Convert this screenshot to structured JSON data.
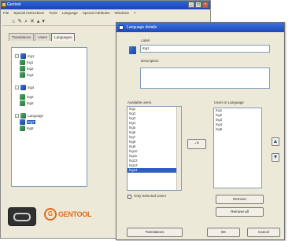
{
  "main_window": {
    "title": "Gentool",
    "menu": [
      "File",
      "Special Instructions",
      "Tools",
      "Language",
      "Special Attributes",
      "Windows",
      "?"
    ],
    "toolbar_icons": [
      "home-icon",
      "pencil-icon",
      "search-icon",
      "delete-icon",
      "up-icon",
      "down-icon"
    ],
    "tabs": [
      "Translations",
      "Users",
      "Languages"
    ],
    "active_tab": 2,
    "tree": [
      {
        "label": "lng1",
        "icon": "blue",
        "expander": "-",
        "selected": false
      },
      {
        "label": "lng1",
        "icon": "green",
        "expander": "",
        "selected": false
      },
      {
        "label": "lng2",
        "icon": "green",
        "expander": "",
        "selected": false
      },
      {
        "label": "lng3",
        "icon": "green",
        "expander": "",
        "selected": false
      },
      {
        "label": "lng4",
        "icon": "blue",
        "expander": "-",
        "selected": false
      },
      {
        "label": "lng5",
        "icon": "green",
        "expander": "",
        "selected": false
      },
      {
        "label": "lng6",
        "icon": "green",
        "expander": "",
        "selected": false
      },
      {
        "label": "Language",
        "icon": "green",
        "expander": "-",
        "selected": false
      },
      {
        "label": "lng7",
        "icon": "blue",
        "expander": "",
        "selected": true
      },
      {
        "label": "lng8",
        "icon": "green",
        "expander": "",
        "selected": false
      }
    ]
  },
  "brand": {
    "logo_letter": "G",
    "logo_word": "GENTOOL",
    "accent": "#e36a1b"
  },
  "dialog": {
    "title": "Language details",
    "label_caption": "Label",
    "label_value": "lng1",
    "description_caption": "Description",
    "available_caption": "Available users",
    "available_users": [
      "lng1",
      "lng2",
      "lng3",
      "lng4",
      "lng5",
      "lng6",
      "lng7",
      "lng8",
      "lng9",
      "lng10",
      "lng11",
      "lng12",
      "lng13",
      "lng14"
    ],
    "available_selected_index": 13,
    "users_caption": "Users in Language",
    "users_in_language": [
      "lng1",
      "lng2",
      "lng3",
      "lng4",
      "lng5"
    ],
    "move_button": "->",
    "only_checkbox_label": "Only Selected Users",
    "only_checkbox_checked": false,
    "remove_button": "Remove",
    "remove_all_button": "Remove all",
    "translations_button": "Translations",
    "ok_button": "OK",
    "cancel_button": "Cancel"
  }
}
